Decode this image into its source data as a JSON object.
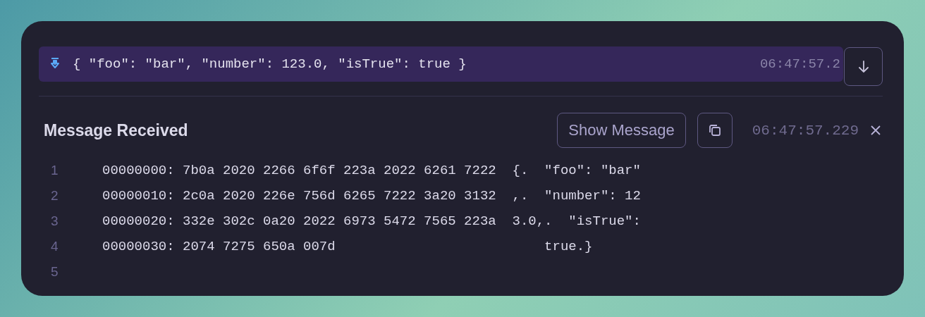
{
  "log_row": {
    "message": "{ \"foo\": \"bar\", \"number\": 123.0, \"isTrue\": true }",
    "time": "06:47:57.2",
    "selected": true
  },
  "detail": {
    "title": "Message Received",
    "show_button": "Show Message",
    "time": "06:47:57.229",
    "lines": [
      {
        "number": "1",
        "text": "00000000: 7b0a 2020 2266 6f6f 223a 2022 6261 7222  {.  \"foo\": \"bar\""
      },
      {
        "number": "2",
        "text": "00000010: 2c0a 2020 226e 756d 6265 7222 3a20 3132  ,.  \"number\": 12"
      },
      {
        "number": "3",
        "text": "00000020: 332e 302c 0a20 2022 6973 5472 7565 223a  3.0,.  \"isTrue\":"
      },
      {
        "number": "4",
        "text": "00000030: 2074 7275 650a 007d                          true.}"
      },
      {
        "number": "5"
      }
    ]
  }
}
